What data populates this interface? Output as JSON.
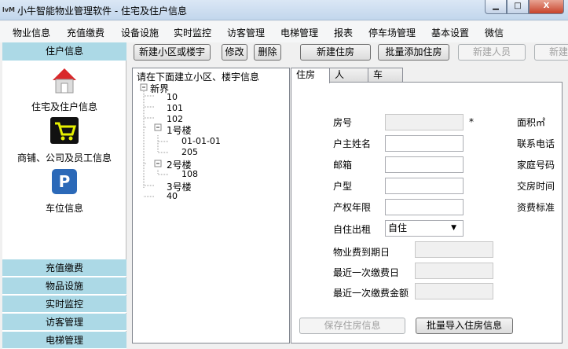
{
  "window": {
    "title": "小牛智能物业管理软件 - 住宅及住户信息",
    "logo": "&#x5c0f;牛",
    "min": "▁",
    "max": "□",
    "close": "X"
  },
  "menu": [
    "物业信息",
    "充值缴费",
    "设备设施",
    "实时监控",
    "访客管理",
    "电梯管理",
    "报表",
    "停车场管理",
    "基本设置",
    "微信"
  ],
  "sidebar": {
    "header": "住户信息",
    "items": [
      {
        "label": "住宅及住户信息",
        "icon": "house-icon"
      },
      {
        "label": "商铺、公司及员工信息",
        "icon": "cart-icon"
      },
      {
        "label": "车位信息",
        "icon": "parking-icon"
      }
    ],
    "bottom": [
      "充值缴费",
      "物品设施",
      "实时监控",
      "访客管理",
      "电梯管理"
    ]
  },
  "toolbar": {
    "new_estate": "新建小区或楼宇",
    "edit": "修改",
    "delete": "删除",
    "new_house": "新建住房",
    "batch_add": "批量添加住房",
    "new_person": "新建人员",
    "new_other": "新建"
  },
  "tree": {
    "hint": "请在下面建立小区、楼宇信息",
    "root": "新界",
    "nodes": [
      "10",
      "101",
      "102",
      "1号楼",
      "01-01-01",
      "205",
      "2号楼",
      "108",
      "3号楼",
      "40"
    ]
  },
  "tabs": [
    "住房",
    "人",
    "车"
  ],
  "form": {
    "room": "房号",
    "star": "*",
    "owner": "户主姓名",
    "email": "邮箱",
    "type": "户型",
    "years": "产权年限",
    "use": "自住出租",
    "use_value": "自住",
    "area": "面积㎡",
    "phone": "联系电话",
    "home_phone": "家庭号码",
    "handover": "交房时间",
    "fee_std": "资费标准",
    "expire": "物业费到期日",
    "last_date": "最近一次缴费日",
    "last_amount": "最近一次缴费金额",
    "save": "保存住房信息",
    "import": "批量导入住房信息"
  }
}
